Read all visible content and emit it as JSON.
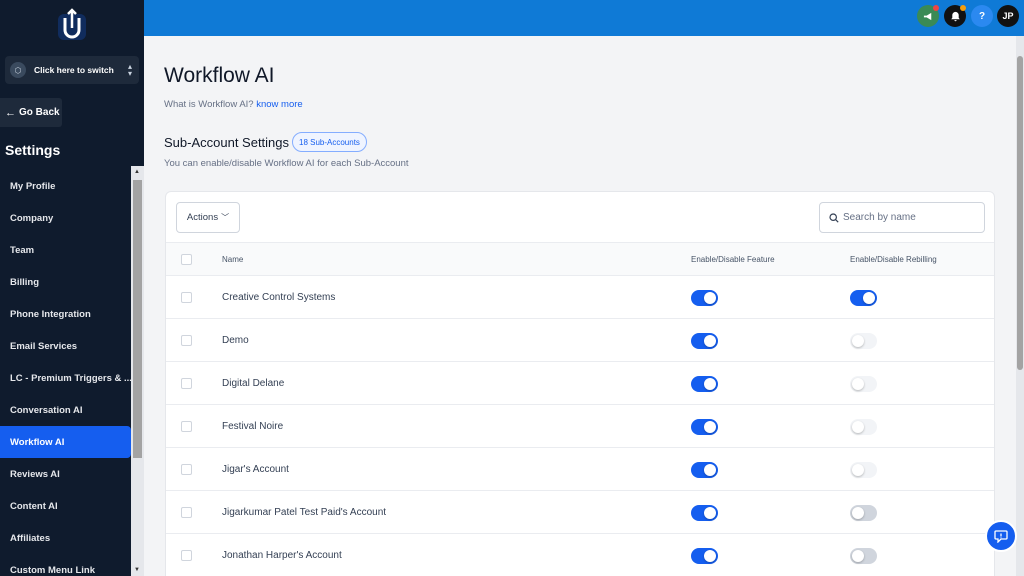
{
  "sidebar": {
    "switcher_label": "Click here to switch",
    "go_back": "Go Back",
    "settings_title": "Settings",
    "items": [
      {
        "label": "My Profile"
      },
      {
        "label": "Company"
      },
      {
        "label": "Team"
      },
      {
        "label": "Billing"
      },
      {
        "label": "Phone Integration"
      },
      {
        "label": "Email Services"
      },
      {
        "label": "LC - Premium Triggers & ..."
      },
      {
        "label": "Conversation AI"
      },
      {
        "label": "Workflow AI"
      },
      {
        "label": "Reviews AI"
      },
      {
        "label": "Content AI"
      },
      {
        "label": "Affiliates"
      },
      {
        "label": "Custom Menu Link"
      }
    ],
    "active_index": 8
  },
  "topbar": {
    "help_label": "?",
    "user_initials": "JP",
    "notification_dot_colors": [
      "#ef4444",
      "#f59e0b"
    ]
  },
  "page": {
    "title": "Workflow AI",
    "subtitle": "What is Workflow AI?",
    "know_more": "know more",
    "section_title": "Sub-Account Settings",
    "badge": "18 Sub-Accounts",
    "section_sub": "You can enable/disable Workflow AI for each Sub-Account"
  },
  "table": {
    "actions_label": "Actions",
    "search_placeholder": "Search by name",
    "columns": [
      "Name",
      "Enable/Disable Feature",
      "Enable/Disable Rebilling"
    ],
    "rows": [
      {
        "name": "Creative Control Systems",
        "feature": "on",
        "rebilling": "on"
      },
      {
        "name": "Demo",
        "feature": "on",
        "rebilling": "off"
      },
      {
        "name": "Digital Delane",
        "feature": "on",
        "rebilling": "off"
      },
      {
        "name": "Festival Noire",
        "feature": "on",
        "rebilling": "off"
      },
      {
        "name": "Jigar's Account",
        "feature": "on",
        "rebilling": "off"
      },
      {
        "name": "Jigarkumar Patel Test Paid's Account",
        "feature": "on",
        "rebilling": "mid"
      },
      {
        "name": "Jonathan Harper's Account",
        "feature": "on",
        "rebilling": "mid"
      }
    ]
  },
  "colors": {
    "accent": "#155eef",
    "sidebar_bg": "#0f1b2d",
    "topbar_bg": "#0f7ad6"
  }
}
